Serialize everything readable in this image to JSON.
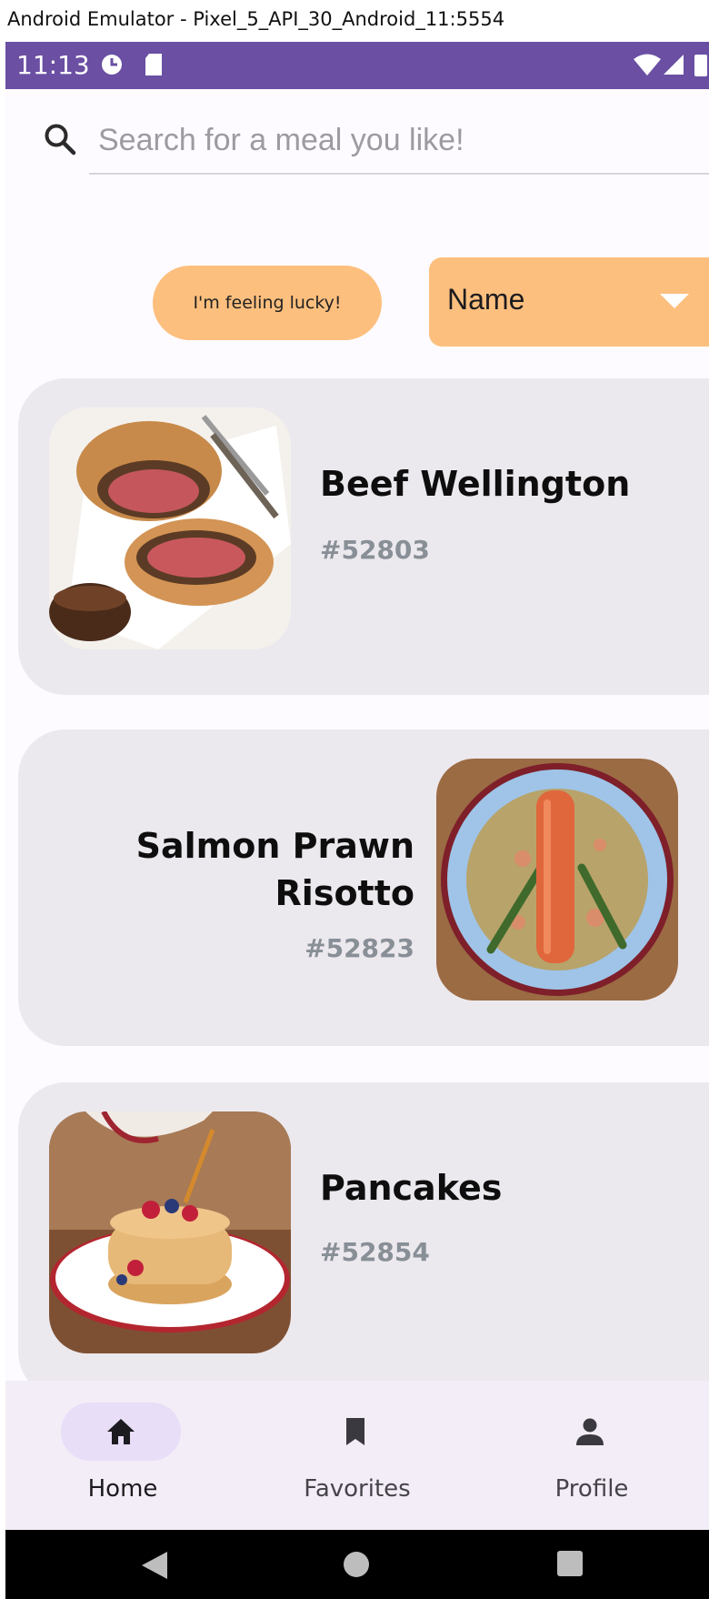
{
  "window": {
    "title": "Android Emulator - Pixel_5_API_30_Android_11:5554"
  },
  "status_bar": {
    "time": "11:13"
  },
  "search": {
    "placeholder": "Search for a meal you like!"
  },
  "controls": {
    "lucky_label": "I'm feeling lucky!",
    "sort_value": "Name"
  },
  "meals": [
    {
      "name": "Beef Wellington",
      "id": "#52803"
    },
    {
      "name": "Salmon Prawn Risotto",
      "id": "#52823"
    },
    {
      "name": "Pancakes",
      "id": "#52854"
    }
  ],
  "bottom_nav": {
    "items": [
      {
        "label": "Home",
        "icon": "home-icon",
        "active": true
      },
      {
        "label": "Favorites",
        "icon": "bookmark-icon",
        "active": false
      },
      {
        "label": "Profile",
        "icon": "person-icon",
        "active": false
      }
    ]
  },
  "colors": {
    "status_bar": "#6a4fa3",
    "accent": "#fdbf7e",
    "card": "#ece9ee",
    "nav_active": "#e8def8"
  }
}
